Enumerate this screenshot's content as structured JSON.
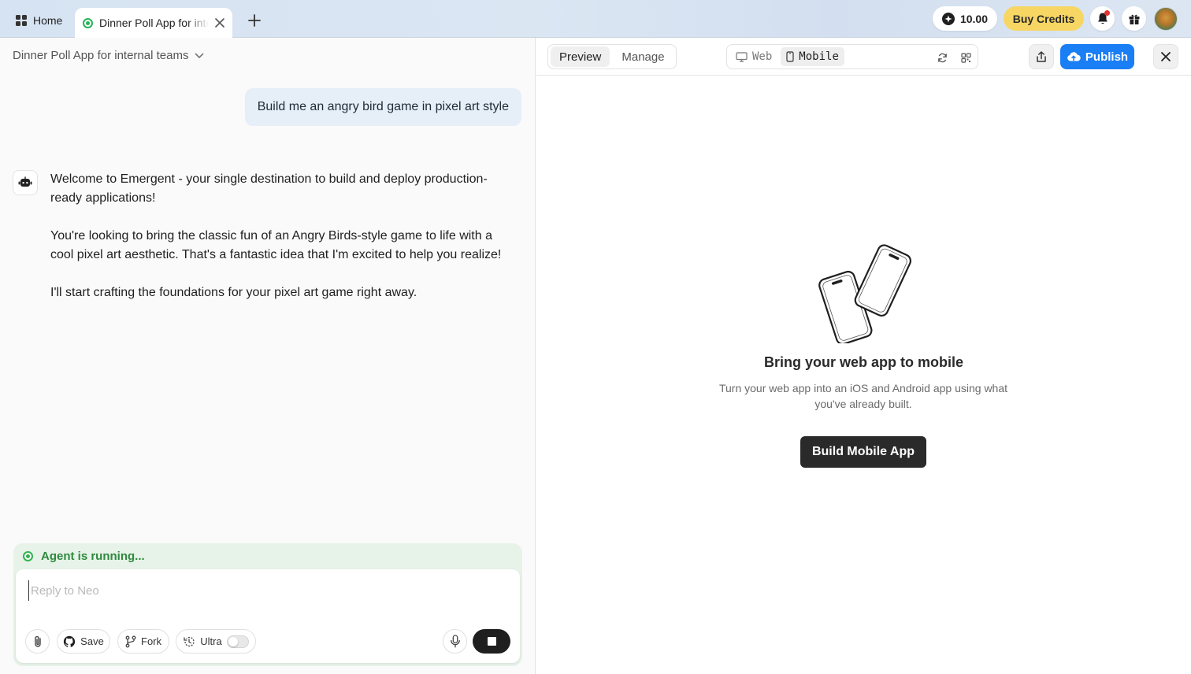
{
  "topbar": {
    "home_label": "Home",
    "project_tab_title": "Dinner Poll App for internal teams",
    "credits_value": "10.00",
    "buy_credits_label": "Buy Credits"
  },
  "chat": {
    "project_name": "Dinner Poll App for internal teams",
    "user_message": "Build me an angry bird game in pixel art style",
    "bot_paragraphs": [
      "Welcome to Emergent - your single destination to build and deploy production-ready applications!",
      "You're looking to bring the classic fun of an Angry Birds-style game to life with a cool pixel art aesthetic. That's a fantastic idea that I'm excited to help you realize!",
      "I'll start crafting the foundations for your pixel art game right away."
    ],
    "agent_status": "Agent is running...",
    "reply_placeholder": "Reply to Neo",
    "reply_value": "",
    "save_label": "Save",
    "fork_label": "Fork",
    "ultra_label": "Ultra",
    "ultra_enabled": false
  },
  "preview": {
    "tabs": [
      {
        "label": "Preview",
        "active": true
      },
      {
        "label": "Manage",
        "active": false
      }
    ],
    "device_web": "Web",
    "device_mobile": "Mobile",
    "publish_label": "Publish",
    "empty_title": "Bring your web app to mobile",
    "empty_subtitle": "Turn your web app into an iOS and Android app using what you've already built.",
    "build_button_label": "Build Mobile App"
  },
  "colors": {
    "accent_blue": "#1a7ef5",
    "buy_credits_yellow": "#f7d663",
    "running_green": "#2fb34f"
  }
}
